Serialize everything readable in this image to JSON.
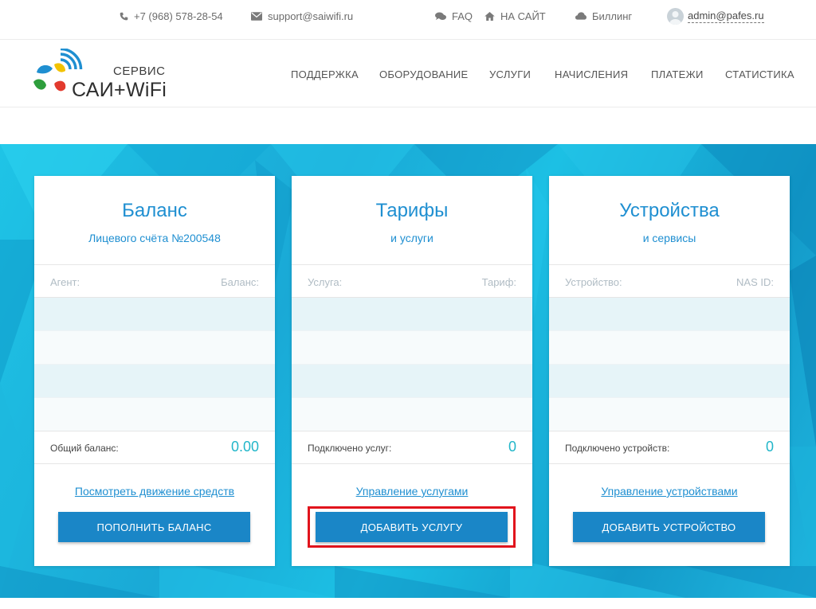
{
  "topbar": {
    "phone": "+7 (968) 578-28-54",
    "email": "support@saiwifi.ru",
    "faq": "FAQ",
    "site": "НА САЙТ",
    "billing": "Биллинг",
    "user": "admin@pafes.ru"
  },
  "logo": {
    "service": "СЕРВИС",
    "name": "САИ+WiFi"
  },
  "nav": {
    "items": [
      "ПОДДЕРЖКА",
      "ОБОРУДОВАНИЕ",
      "УСЛУГИ",
      "НАЧИСЛЕНИЯ",
      "ПЛАТЕЖИ",
      "СТАТИСТИКА"
    ]
  },
  "cards": [
    {
      "title": "Баланс",
      "subtitle": "Лицевого счёта №200548",
      "col_left": "Агент:",
      "col_right": "Баланс:",
      "total_label": "Общий баланс:",
      "total_value": "0.00",
      "link": "Посмотреть движение средств",
      "button": "ПОПОЛНИТЬ БАЛАНС"
    },
    {
      "title": "Тарифы",
      "subtitle": "и услуги",
      "col_left": "Услуга:",
      "col_right": "Тариф:",
      "total_label": "Подключено услуг:",
      "total_value": "0",
      "link": "Управление услугами",
      "button": "ДОБАВИТЬ УСЛУГУ"
    },
    {
      "title": "Устройства",
      "subtitle": "и сервисы",
      "col_left": "Устройство:",
      "col_right": "NAS ID:",
      "total_label": "Подключено устройств:",
      "total_value": "0",
      "link": "Управление устройствами",
      "button": "ДОБАВИТЬ УСТРОЙСТВО"
    }
  ],
  "colors": {
    "accent": "#1f8fd1",
    "button": "#1a86c7",
    "value": "#22b6c9",
    "highlight": "#e1141c",
    "hero": "#1fb6df"
  }
}
